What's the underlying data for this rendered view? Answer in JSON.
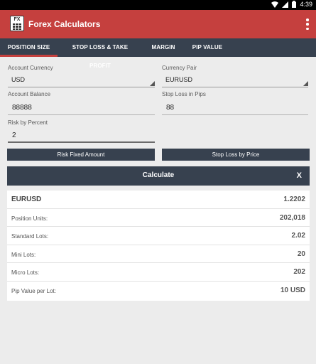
{
  "status_bar": {
    "time": "4:39"
  },
  "app": {
    "title": "Forex Calculators",
    "logo_text": "FX"
  },
  "tabs": [
    {
      "label": "POSITION SIZE",
      "active": true
    },
    {
      "label": "STOP LOSS & TAKE PROFIT",
      "active": false
    },
    {
      "label": "MARGIN",
      "active": false
    },
    {
      "label": "PIP VALUE",
      "active": false
    }
  ],
  "form": {
    "account_currency": {
      "label": "Account Currency",
      "value": "USD"
    },
    "currency_pair": {
      "label": "Currency Pair",
      "value": "EURUSD"
    },
    "account_balance": {
      "label": "Account Balance",
      "value": "88888"
    },
    "stop_loss_pips": {
      "label": "Stop Loss in Pips",
      "value": "88"
    },
    "risk_percent": {
      "label": "Risk by Percent",
      "value": "2"
    }
  },
  "buttons": {
    "risk_fixed": "Risk Fixed Amount",
    "stop_loss_price": "Stop Loss by Price",
    "calculate": "Calculate",
    "clear": "X"
  },
  "results": {
    "pair": "EURUSD",
    "rate": "1.2202",
    "rows": [
      {
        "label": "Position Units:",
        "value": "202,018"
      },
      {
        "label": "Standard Lots:",
        "value": "2.02"
      },
      {
        "label": "Mini Lots:",
        "value": "20"
      },
      {
        "label": "Micro Lots:",
        "value": "202"
      },
      {
        "label": "Pip Value per Lot:",
        "value": "10 USD"
      }
    ]
  },
  "colors": {
    "primary": "#c5403e",
    "dark": "#37414f",
    "background": "#ececec"
  }
}
